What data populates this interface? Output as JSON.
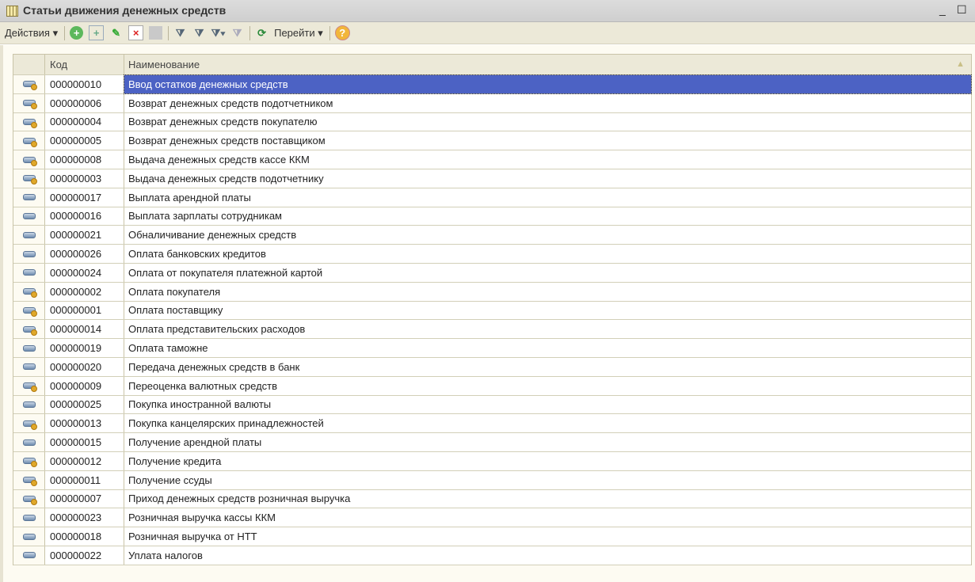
{
  "window": {
    "title": "Статьи движения денежных средств",
    "minimize": "_",
    "maximize": "☐"
  },
  "toolbar": {
    "actions_label": "Действия ▾",
    "goto_label": "Перейти ▾"
  },
  "table": {
    "headers": {
      "code": "Код",
      "name": "Наименование"
    },
    "selected_index": 0,
    "rows": [
      {
        "code": "000000010",
        "name": "Ввод остатков денежных средств",
        "marked": true
      },
      {
        "code": "000000006",
        "name": "Возврат денежных средств подотчетником",
        "marked": true
      },
      {
        "code": "000000004",
        "name": "Возврат денежных средств покупателю",
        "marked": true
      },
      {
        "code": "000000005",
        "name": "Возврат денежных средств поставщиком",
        "marked": true
      },
      {
        "code": "000000008",
        "name": "Выдача денежных средств кассе ККМ",
        "marked": true
      },
      {
        "code": "000000003",
        "name": "Выдача денежных средств подотчетнику",
        "marked": true
      },
      {
        "code": "000000017",
        "name": "Выплата арендной платы",
        "marked": false
      },
      {
        "code": "000000016",
        "name": "Выплата зарплаты сотрудникам",
        "marked": false
      },
      {
        "code": "000000021",
        "name": "Обналичивание денежных средств",
        "marked": false
      },
      {
        "code": "000000026",
        "name": "Оплата банковских кредитов",
        "marked": false
      },
      {
        "code": "000000024",
        "name": "Оплата от покупателя платежной картой",
        "marked": false
      },
      {
        "code": "000000002",
        "name": "Оплата покупателя",
        "marked": true
      },
      {
        "code": "000000001",
        "name": "Оплата поставщику",
        "marked": true
      },
      {
        "code": "000000014",
        "name": "Оплата представительских расходов",
        "marked": true
      },
      {
        "code": "000000019",
        "name": "Оплата таможне",
        "marked": false
      },
      {
        "code": "000000020",
        "name": "Передача денежных средств в банк",
        "marked": false
      },
      {
        "code": "000000009",
        "name": "Переоценка валютных средств",
        "marked": true
      },
      {
        "code": "000000025",
        "name": "Покупка иностранной валюты",
        "marked": false
      },
      {
        "code": "000000013",
        "name": "Покупка канцелярских принадлежностей",
        "marked": true
      },
      {
        "code": "000000015",
        "name": "Получение арендной платы",
        "marked": false
      },
      {
        "code": "000000012",
        "name": "Получение кредита",
        "marked": true
      },
      {
        "code": "000000011",
        "name": "Получение ссуды",
        "marked": true
      },
      {
        "code": "000000007",
        "name": "Приход денежных средств розничная выручка",
        "marked": true
      },
      {
        "code": "000000023",
        "name": "Розничная выручка кассы ККМ",
        "marked": false
      },
      {
        "code": "000000018",
        "name": "Розничная выручка от НТТ",
        "marked": false
      },
      {
        "code": "000000022",
        "name": "Уплата налогов",
        "marked": false
      }
    ]
  }
}
